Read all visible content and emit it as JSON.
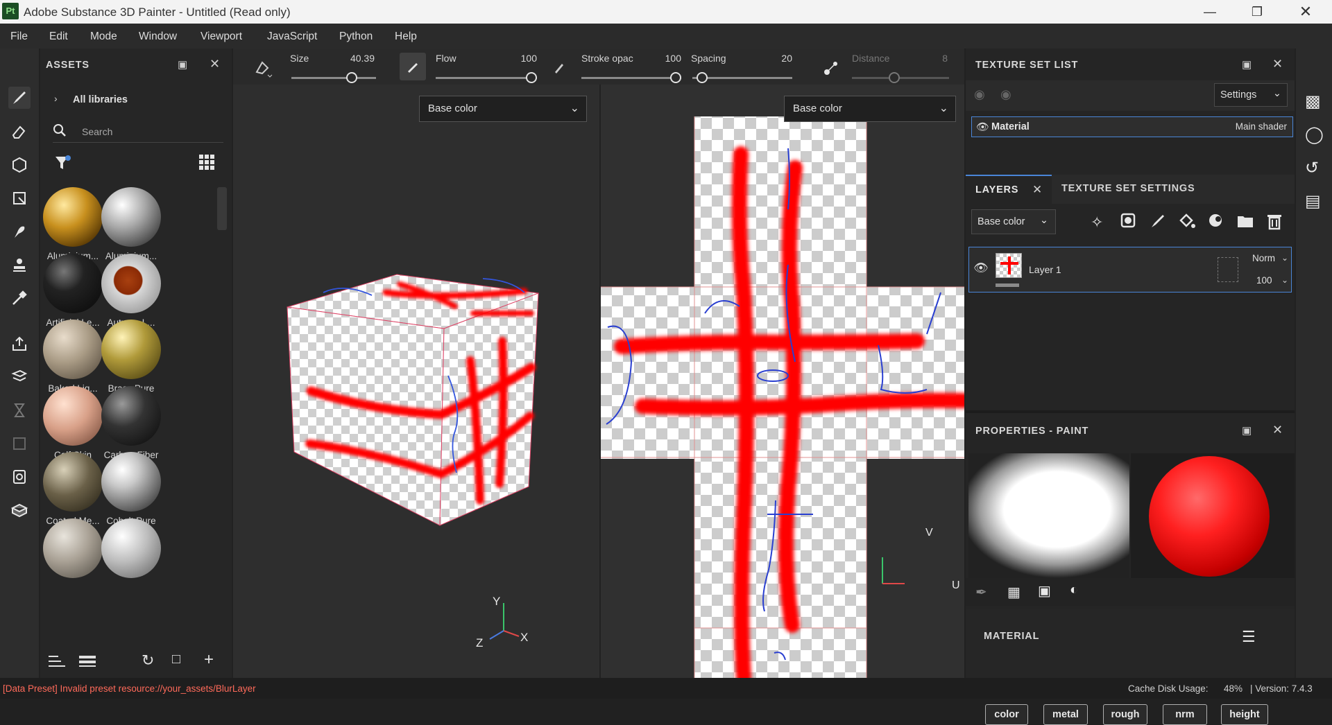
{
  "window": {
    "title": "Adobe Substance 3D Painter - Untitled (Read only)",
    "logo": "Pt"
  },
  "menu": [
    "File",
    "Edit",
    "Mode",
    "Window",
    "Viewport",
    "JavaScript",
    "Python",
    "Help"
  ],
  "assets": {
    "title": "ASSETS",
    "library": "All libraries",
    "search_placeholder": "Search",
    "items": [
      {
        "label": "Aluminium...",
        "color": "gold-sphere"
      },
      {
        "label": "Aluminium...",
        "color": "silver-sphere"
      },
      {
        "label": "Artificial Le...",
        "color": "black-sphere"
      },
      {
        "label": "Autumn L...",
        "color": "leaf-sphere"
      },
      {
        "label": "Baked Lig...",
        "color": "beige-sphere"
      },
      {
        "label": "Brass Pure",
        "color": "brass-sphere"
      },
      {
        "label": "Calf Skin",
        "color": "skin-sphere"
      },
      {
        "label": "Carbon Fiber",
        "color": "carbon-sphere"
      },
      {
        "label": "Coated Me...",
        "color": "olive-sphere"
      },
      {
        "label": "Cobalt Pure",
        "color": "chrome-sphere"
      },
      {
        "label": "",
        "color": "stone-sphere"
      },
      {
        "label": "",
        "color": "grey-sphere"
      }
    ]
  },
  "toolbar": {
    "size_label": "Size",
    "size_value": "40.39",
    "flow_label": "Flow",
    "flow_value": "100",
    "stroke_label": "Stroke opac",
    "stroke_value": "100",
    "spacing_label": "Spacing",
    "spacing_value": "20",
    "distance_label": "Distance",
    "distance_value": "8"
  },
  "viewport3d": {
    "channel": "Base color",
    "axes": {
      "y": "Y",
      "z": "Z",
      "x": "X"
    }
  },
  "viewport2d": {
    "channel": "Base color",
    "axes": {
      "v": "V",
      "u": "U"
    }
  },
  "texture_set_list": {
    "title": "TEXTURE SET LIST",
    "settings": "Settings",
    "material_name": "Material",
    "shader": "Main shader"
  },
  "layers": {
    "tab_layers": "LAYERS",
    "tab_tss": "TEXTURE SET SETTINGS",
    "channel": "Base color",
    "layer": {
      "name": "Layer 1",
      "blend": "Norm",
      "opacity": "100"
    }
  },
  "properties": {
    "title": "PROPERTIES - PAINT",
    "material_title": "MATERIAL",
    "chips": [
      "color",
      "metal",
      "rough",
      "nrm",
      "height"
    ]
  },
  "status": {
    "error": "[Data Preset] Invalid preset resource://your_assets/BlurLayer",
    "cache": "Cache Disk Usage:",
    "cache_value": "48%",
    "version": "| Version: 7.4.3"
  },
  "colors": {
    "accent": "#4a86d8",
    "paint": "#ff0000",
    "error": "#ff6a5a"
  }
}
